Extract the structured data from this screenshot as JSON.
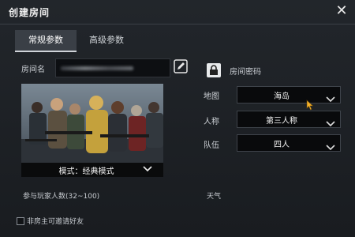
{
  "window": {
    "title": "创建房间",
    "close_icon": "close-icon"
  },
  "tabs": {
    "general": "常规参数",
    "advanced": "高级参数"
  },
  "room": {
    "name_label": "房间名"
  },
  "banner": {
    "mode_text": "模式：经典模式"
  },
  "players": {
    "label": "参与玩家人数(32~100)"
  },
  "password": {
    "label": "房间密码"
  },
  "settings": {
    "map_label": "地图",
    "map_value": "海岛",
    "perspective_label": "人称",
    "perspective_value": "第三人称",
    "team_label": "队伍",
    "team_value": "四人"
  },
  "weather": {
    "label": "天气"
  },
  "invite": {
    "label": "非房主可邀请好友",
    "checked": false
  }
}
